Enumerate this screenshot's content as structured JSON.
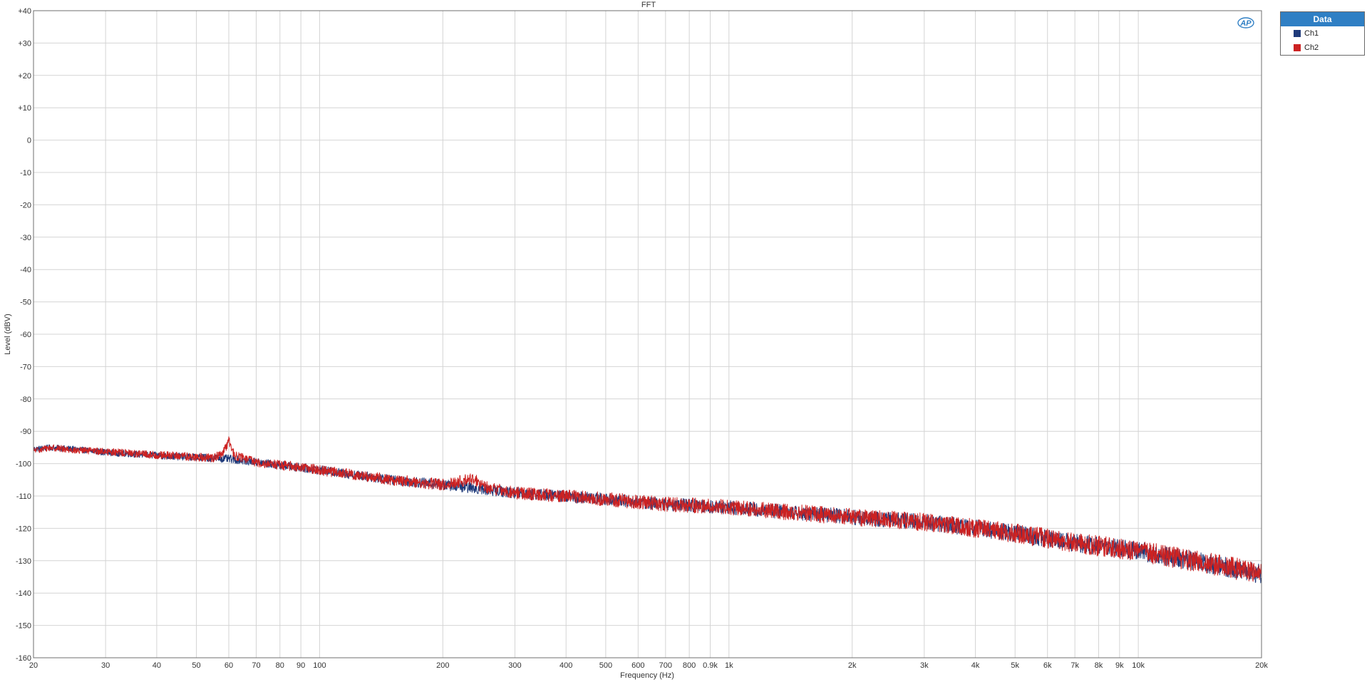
{
  "chart_data": {
    "type": "line",
    "title": "FFT",
    "xlabel": "Frequency (Hz)",
    "ylabel": "Level (dBV)",
    "xscale": "log",
    "xlim": [
      20,
      20000
    ],
    "ylim": [
      -160,
      40
    ],
    "grid": true,
    "legend_position": "top-right outside",
    "legend_title": "Data",
    "x_ticks": [
      {
        "v": 20,
        "label": "20"
      },
      {
        "v": 30,
        "label": "30"
      },
      {
        "v": 40,
        "label": "40"
      },
      {
        "v": 50,
        "label": "50"
      },
      {
        "v": 60,
        "label": "60"
      },
      {
        "v": 70,
        "label": "70"
      },
      {
        "v": 80,
        "label": "80"
      },
      {
        "v": 90,
        "label": "90"
      },
      {
        "v": 100,
        "label": "100"
      },
      {
        "v": 200,
        "label": "200"
      },
      {
        "v": 300,
        "label": "300"
      },
      {
        "v": 400,
        "label": "400"
      },
      {
        "v": 500,
        "label": "500"
      },
      {
        "v": 600,
        "label": "600"
      },
      {
        "v": 700,
        "label": "700"
      },
      {
        "v": 800,
        "label": "800"
      },
      {
        "v": 900,
        "label": "0.9k"
      },
      {
        "v": 1000,
        "label": "1k"
      },
      {
        "v": 2000,
        "label": "2k"
      },
      {
        "v": 3000,
        "label": "3k"
      },
      {
        "v": 4000,
        "label": "4k"
      },
      {
        "v": 5000,
        "label": "5k"
      },
      {
        "v": 6000,
        "label": "6k"
      },
      {
        "v": 7000,
        "label": "7k"
      },
      {
        "v": 8000,
        "label": "8k"
      },
      {
        "v": 9000,
        "label": "9k"
      },
      {
        "v": 10000,
        "label": "10k"
      },
      {
        "v": 20000,
        "label": "20k"
      }
    ],
    "y_ticks": [
      {
        "v": 40,
        "label": "+40"
      },
      {
        "v": 30,
        "label": "+30"
      },
      {
        "v": 20,
        "label": "+20"
      },
      {
        "v": 10,
        "label": "+10"
      },
      {
        "v": 0,
        "label": "0"
      },
      {
        "v": -10,
        "label": "-10"
      },
      {
        "v": -20,
        "label": "-20"
      },
      {
        "v": -30,
        "label": "-30"
      },
      {
        "v": -40,
        "label": "-40"
      },
      {
        "v": -50,
        "label": "-50"
      },
      {
        "v": -60,
        "label": "-60"
      },
      {
        "v": -70,
        "label": "-70"
      },
      {
        "v": -80,
        "label": "-80"
      },
      {
        "v": -90,
        "label": "-90"
      },
      {
        "v": -100,
        "label": "-100"
      },
      {
        "v": -110,
        "label": "-110"
      },
      {
        "v": -120,
        "label": "-120"
      },
      {
        "v": -130,
        "label": "-130"
      },
      {
        "v": -140,
        "label": "-140"
      },
      {
        "v": -150,
        "label": "-150"
      },
      {
        "v": -160,
        "label": "-160"
      }
    ],
    "series": [
      {
        "name": "Ch1",
        "color": "#1f3a7a",
        "noise_db": 2.5,
        "points": [
          [
            20,
            -95.5
          ],
          [
            22,
            -95
          ],
          [
            25,
            -95.5
          ],
          [
            30,
            -96.5
          ],
          [
            35,
            -97
          ],
          [
            40,
            -97.5
          ],
          [
            45,
            -97.8
          ],
          [
            50,
            -98
          ],
          [
            55,
            -98.3
          ],
          [
            60,
            -98.5
          ],
          [
            70,
            -99.5
          ],
          [
            80,
            -100.5
          ],
          [
            90,
            -101.2
          ],
          [
            100,
            -102
          ],
          [
            150,
            -105
          ],
          [
            200,
            -106.5
          ],
          [
            300,
            -109
          ],
          [
            500,
            -111
          ],
          [
            700,
            -112.5
          ],
          [
            1000,
            -113.5
          ],
          [
            2000,
            -116.5
          ],
          [
            3000,
            -118
          ],
          [
            5000,
            -121.5
          ],
          [
            7000,
            -124.5
          ],
          [
            10000,
            -127
          ],
          [
            15000,
            -131
          ],
          [
            20000,
            -134
          ]
        ]
      },
      {
        "name": "Ch2",
        "color": "#cc2222",
        "noise_db": 2.8,
        "points": [
          [
            20,
            -96
          ],
          [
            22,
            -95
          ],
          [
            25,
            -95.8
          ],
          [
            30,
            -96.3
          ],
          [
            35,
            -96.8
          ],
          [
            40,
            -97.4
          ],
          [
            45,
            -97.6
          ],
          [
            50,
            -98
          ],
          [
            55,
            -98.2
          ],
          [
            58,
            -97
          ],
          [
            60,
            -93
          ],
          [
            62,
            -97.5
          ],
          [
            70,
            -99.5
          ],
          [
            80,
            -100.5
          ],
          [
            90,
            -101
          ],
          [
            100,
            -102
          ],
          [
            150,
            -105
          ],
          [
            200,
            -106.5
          ],
          [
            240,
            -104.5
          ],
          [
            245,
            -106.8
          ],
          [
            300,
            -109
          ],
          [
            500,
            -111
          ],
          [
            700,
            -112.5
          ],
          [
            1000,
            -113.5
          ],
          [
            2000,
            -116.5
          ],
          [
            3000,
            -118
          ],
          [
            5000,
            -121.5
          ],
          [
            7000,
            -124.5
          ],
          [
            10000,
            -127
          ],
          [
            15000,
            -131
          ],
          [
            20000,
            -134
          ]
        ]
      }
    ]
  }
}
